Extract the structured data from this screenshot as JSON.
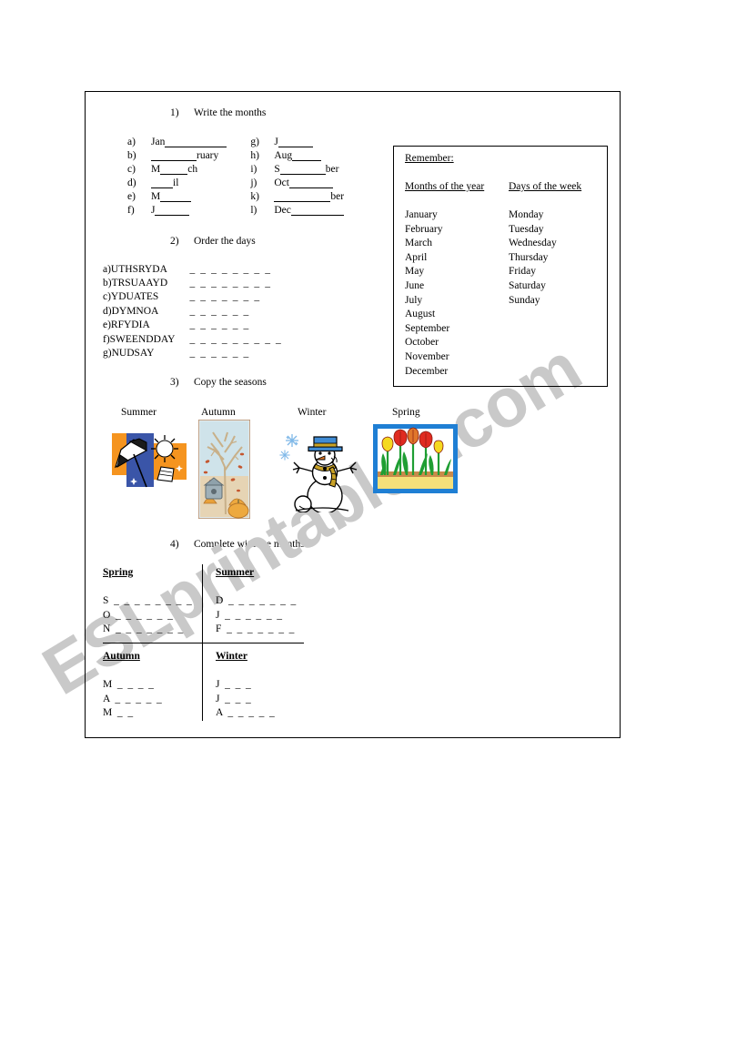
{
  "watermark": {
    "text": "ESLprintables.com"
  },
  "exercises": [
    {
      "number": "1)",
      "title": "Write the months"
    },
    {
      "number": "2)",
      "title": "Order the days"
    },
    {
      "number": "3)",
      "title": "Copy the seasons"
    },
    {
      "number": "4)",
      "title": "Complete with the months"
    }
  ],
  "ex1": {
    "left": [
      {
        "label": "a)",
        "pre": "Jan",
        "line": 68,
        "post": ""
      },
      {
        "label": "b)",
        "pre": "",
        "line": 50,
        "post": "ruary"
      },
      {
        "label": "c)",
        "pre": "M",
        "line": 30,
        "post": "ch"
      },
      {
        "label": "d)",
        "pre": "",
        "line": 24,
        "post": "il"
      },
      {
        "label": "e)",
        "pre": "M",
        "line": 34,
        "post": ""
      },
      {
        "label": "f)",
        "pre": "J",
        "line": 38,
        "post": ""
      }
    ],
    "right": [
      {
        "label": "g)",
        "pre": "J",
        "line": 38,
        "post": ""
      },
      {
        "label": "h)",
        "pre": "Aug",
        "line": 32,
        "post": ""
      },
      {
        "label": "i)",
        "pre": "S",
        "line": 50,
        "post": "ber"
      },
      {
        "label": "j)",
        "pre": "Oct",
        "line": 48,
        "post": ""
      },
      {
        "label": "k)",
        "pre": "",
        "line": 62,
        "post": "ber"
      },
      {
        "label": "l)",
        "pre": "Dec",
        "line": 58,
        "post": ""
      }
    ]
  },
  "remember": {
    "title": "Remember:",
    "months_heading": "Months of the year",
    "days_heading": "Days of the week",
    "months": [
      "January",
      "February",
      "March",
      "April",
      "May",
      "June",
      "July",
      "August",
      "September",
      "October",
      "November",
      "December"
    ],
    "days": [
      "Monday",
      "Tuesday",
      "Wednesday",
      "Thursday",
      "Friday",
      "Saturday",
      "Sunday"
    ]
  },
  "ex2": {
    "items": [
      {
        "label": "a)",
        "scrambled": "UTHSRYDA",
        "blank": "_ _ _ _ _ _ _ _"
      },
      {
        "label": "b)",
        "scrambled": "TRSUAAYD",
        "blank": "_ _ _ _ _ _ _ _"
      },
      {
        "label": "c)",
        "scrambled": "YDUATES",
        "blank": "_ _ _ _ _ _ _"
      },
      {
        "label": "d)",
        "scrambled": "DYMNOA",
        "blank": "_ _ _ _ _ _"
      },
      {
        "label": "e)",
        "scrambled": "RFYDIA",
        "blank": "_ _ _ _ _ _"
      },
      {
        "label": "f)",
        "scrambled": "SWEENDDAY",
        "blank": "_ _ _ _ _ _ _ _ _"
      },
      {
        "label": "g)",
        "scrambled": "NUDSAY",
        "blank": "_ _ _ _ _ _"
      }
    ]
  },
  "ex3": {
    "seasons": [
      {
        "name": "Summer",
        "icon": "beach-umbrella-sun-icon"
      },
      {
        "name": "Autumn",
        "icon": "autumn-tree-pumpkin-icon"
      },
      {
        "name": "Winter",
        "icon": "snowman-snowflake-icon"
      },
      {
        "name": "Spring",
        "icon": "tulips-flowers-icon"
      }
    ]
  },
  "ex4": {
    "cells": [
      {
        "heading": "Spring",
        "lines": [
          "S _ _ _ _ _ _ _ _",
          "O _ _ _ _ _ _",
          "N _ _ _ _ _ _ _"
        ]
      },
      {
        "heading": "Summer",
        "lines": [
          "D _ _ _ _ _ _ _",
          "J _ _ _ _ _ _",
          "F _ _ _ _ _ _ _"
        ]
      },
      {
        "heading": "Autumn",
        "lines": [
          "M _ _ _ _",
          "A _ _ _ _ _",
          "M _ _"
        ]
      },
      {
        "heading": "Winter",
        "lines": [
          "J _ _ _",
          "J _ _ _",
          "A _ _ _ _ _"
        ]
      }
    ]
  },
  "colors": {
    "ink": "#000000",
    "watermark": "#c9c9c9",
    "summer_blue": "#3a55a8",
    "summer_orange": "#f5941f",
    "winter_hat_blue": "#3f8bd4",
    "winter_scarf": "#c9a227",
    "spring_frame_blue": "#1f7fd4",
    "spring_red": "#e02b20",
    "spring_yellow": "#f5d91f",
    "spring_green": "#1f9e33",
    "autumn_sky": "#cfe3ea",
    "autumn_leaf": "#c4562e"
  }
}
